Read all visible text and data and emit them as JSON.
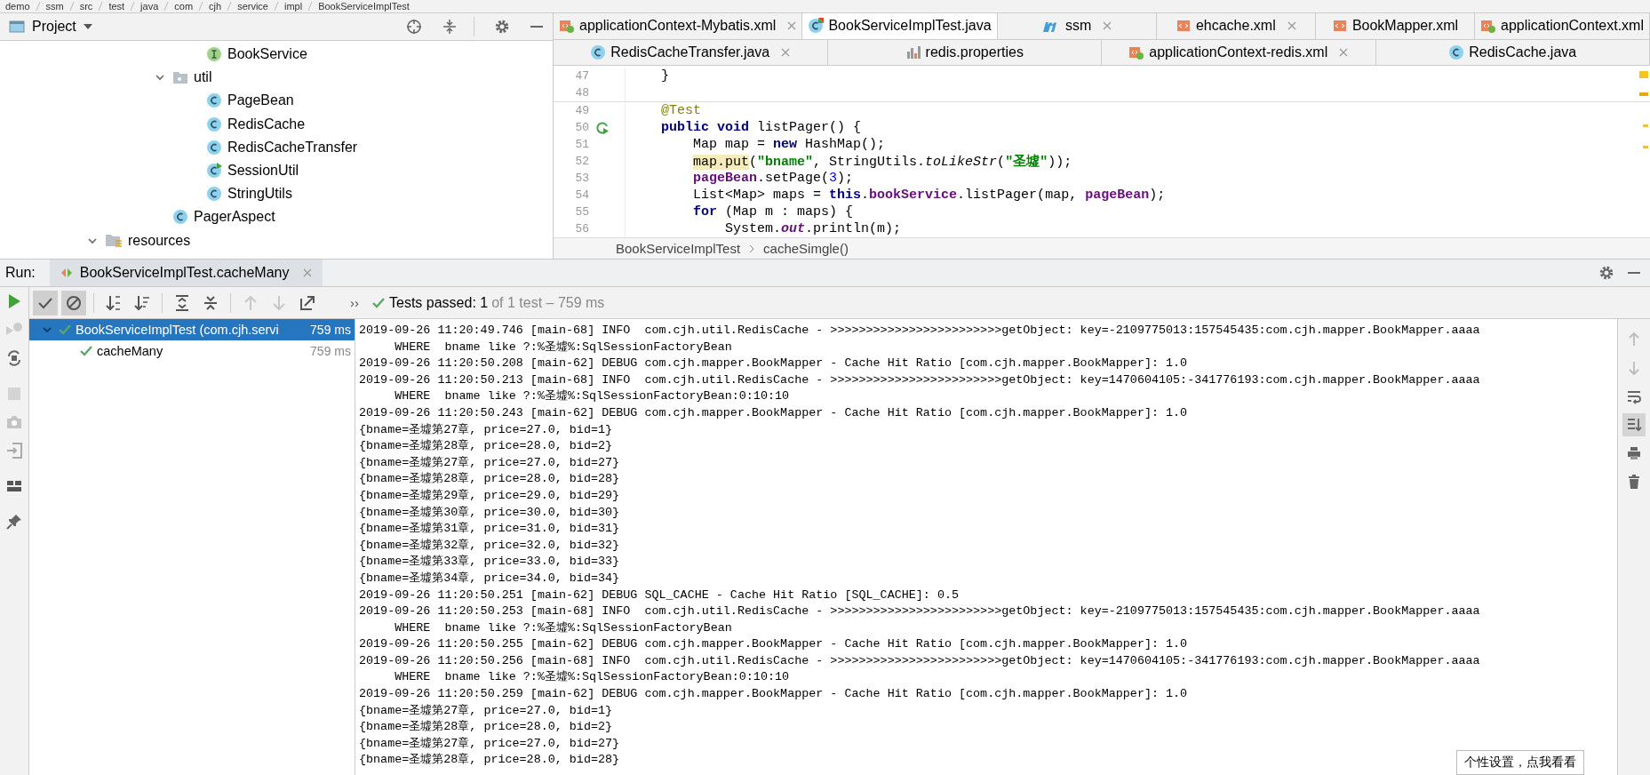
{
  "breadcrumbs": [
    "demo",
    "ssm",
    "src",
    "test",
    "java",
    "com",
    "cjh",
    "service",
    "impl",
    "BookServiceImplTest"
  ],
  "project_panel": {
    "title": "Project",
    "tree": [
      {
        "children": [
          {
            "children": [
              {
                "children": [
                  {
                    "label": "BookService",
                    "kind": "interface"
                  }
                ]
              },
              {
                "label": "util",
                "kind": "package",
                "expanded": true,
                "children": [
                  {
                    "label": "PageBean",
                    "kind": "class"
                  },
                  {
                    "label": "RedisCache",
                    "kind": "class"
                  },
                  {
                    "label": "RedisCacheTransfer",
                    "kind": "class"
                  },
                  {
                    "label": "SessionUtil",
                    "kind": "class-runnable"
                  },
                  {
                    "label": "StringUtils",
                    "kind": "class"
                  }
                ]
              },
              {
                "label": "PagerAspect",
                "kind": "class"
              }
            ]
          }
        ]
      },
      {
        "label": "resources",
        "kind": "resources",
        "expanded": true
      }
    ]
  },
  "editor_tab_rows": [
    {
      "tabs": [
        {
          "title": "applicationContext-Mybatis.xml",
          "kind": "spring-xml",
          "selected": false,
          "closable": true
        },
        {
          "title": "BookServiceImplTest.java",
          "kind": "test-class",
          "selected": true,
          "closable": false
        },
        {
          "title": "ssm",
          "kind": "maven",
          "selected": false,
          "closable": true
        },
        {
          "title": "ehcache.xml",
          "kind": "xml",
          "selected": false,
          "closable": true
        },
        {
          "title": "BookMapper.xml",
          "kind": "xml",
          "selected": false,
          "closable": false
        },
        {
          "title": "applicationContext.xml",
          "kind": "spring-xml",
          "selected": false,
          "closable": false
        }
      ]
    },
    {
      "tabs": [
        {
          "title": "RedisCacheTransfer.java",
          "kind": "class",
          "selected": false,
          "closable": true
        },
        {
          "title": "redis.properties",
          "kind": "properties",
          "selected": false,
          "closable": false
        },
        {
          "title": "applicationContext-redis.xml",
          "kind": "spring-xml",
          "selected": false,
          "closable": true
        },
        {
          "title": "RedisCache.java",
          "kind": "class",
          "selected": false,
          "closable": false
        }
      ]
    }
  ],
  "code_lines": [
    {
      "number": "47",
      "run_icon": false,
      "tokens": [
        {
          "text": "    }",
          "kind": "plain"
        }
      ]
    },
    {
      "number": "48",
      "run_icon": false
    },
    {
      "number": "49",
      "run_icon": false,
      "tokens": [
        {
          "text": "    @Test",
          "kind": "annotation"
        }
      ]
    },
    {
      "number": "50",
      "run_icon": true,
      "tokens": [
        {
          "text": "    public void",
          "kind": "keyword"
        },
        {
          "text": " listPager() {",
          "kind": "plain"
        }
      ]
    },
    {
      "number": "51",
      "run_icon": false,
      "tokens": [
        {
          "text": "        Map map = ",
          "kind": "plain"
        },
        {
          "text": "new",
          "kind": "keyword"
        },
        {
          "text": " HashMap();",
          "kind": "plain"
        }
      ]
    },
    {
      "number": "52",
      "run_icon": false,
      "tokens": [
        {
          "text": "        map.put",
          "kind": "highlight"
        },
        {
          "text": "(",
          "kind": "plain"
        },
        {
          "text": "\"bname\"",
          "kind": "string"
        },
        {
          "text": ", StringUtils.",
          "kind": "plain"
        },
        {
          "text": "toLikeStr",
          "kind": "static-method"
        },
        {
          "text": "(",
          "kind": "plain"
        },
        {
          "text": "\"圣墟\"",
          "kind": "string"
        },
        {
          "text": "));",
          "kind": "plain"
        }
      ]
    },
    {
      "number": "53",
      "run_icon": false,
      "tokens": [
        {
          "text": "        pageBean",
          "kind": "field"
        },
        {
          "text": ".setPage(",
          "kind": "plain"
        },
        {
          "text": "3",
          "kind": "number"
        },
        {
          "text": ");",
          "kind": "plain"
        }
      ]
    },
    {
      "number": "54",
      "run_icon": false,
      "tokens": [
        {
          "text": "        List<Map> maps = ",
          "kind": "plain"
        },
        {
          "text": "this",
          "kind": "keyword"
        },
        {
          "text": ".",
          "kind": "plain"
        },
        {
          "text": "bookService",
          "kind": "field"
        },
        {
          "text": ".listPager(map, ",
          "kind": "plain"
        },
        {
          "text": "pageBean",
          "kind": "field"
        },
        {
          "text": ");",
          "kind": "plain"
        }
      ]
    },
    {
      "number": "55",
      "run_icon": false,
      "tokens": [
        {
          "text": "        for",
          "kind": "keyword"
        },
        {
          "text": " (Map m : maps) {",
          "kind": "plain"
        }
      ]
    },
    {
      "number": "56",
      "run_icon": false,
      "tokens": [
        {
          "text": "            System.",
          "kind": "plain"
        },
        {
          "text": "out",
          "kind": "static-field"
        },
        {
          "text": ".println(m);",
          "kind": "plain"
        }
      ]
    }
  ],
  "editor_breadcrumbs": [
    "BookServiceImplTest",
    "cacheSimgle()"
  ],
  "run_panel": {
    "label": "Run:",
    "tab": "BookServiceImplTest.cacheMany",
    "side_tools": [
      {
        "kind": "run",
        "disabled": false
      },
      {
        "kind": "rerun-failed",
        "disabled": true
      },
      {
        "kind": "auto-test",
        "disabled": false
      },
      {
        "kind": "stop",
        "disabled": true
      },
      {
        "kind": "camera",
        "disabled": false
      },
      {
        "kind": "import",
        "disabled": false
      },
      {
        "kind": "layout",
        "disabled": false
      },
      {
        "kind": "pin",
        "disabled": false
      }
    ],
    "toolbar": [
      {
        "kind": "check",
        "selected": true,
        "disabled": false
      },
      {
        "kind": "ignored",
        "selected": true,
        "disabled": false
      },
      {
        "kind": "sort-alpha",
        "selected": false,
        "disabled": false
      },
      {
        "kind": "sort-duration",
        "selected": false,
        "disabled": false
      },
      {
        "kind": "expand",
        "selected": false,
        "disabled": false
      },
      {
        "kind": "collapse",
        "selected": false,
        "disabled": false
      },
      {
        "kind": "up",
        "selected": false,
        "disabled": true
      },
      {
        "kind": "down",
        "selected": false,
        "disabled": true
      },
      {
        "kind": "export",
        "selected": false,
        "disabled": false
      }
    ],
    "more": "››",
    "status_main": "Tests passed: 1",
    "status_detail": "of 1 test – 759 ms",
    "tests": [
      {
        "label": "BookServiceImplTest (com.cjh.servi",
        "duration": "759 ms",
        "passed": true,
        "selected": true,
        "expanded": true,
        "children": [
          {
            "label": "cacheMany",
            "duration": "759 ms",
            "passed": true,
            "selected": false
          }
        ]
      }
    ],
    "console_tools": [
      {
        "kind": "up",
        "selected": false
      },
      {
        "kind": "down",
        "selected": false
      },
      {
        "kind": "wrap",
        "selected": false
      },
      {
        "kind": "scroll-end",
        "selected": true
      },
      {
        "kind": "print",
        "selected": false
      },
      {
        "kind": "trash",
        "selected": false
      }
    ],
    "console_lines": [
      "2019-09-26 11:20:49.746 [main-68] INFO  com.cjh.util.RedisCache - >>>>>>>>>>>>>>>>>>>>>>>>getObject: key=-2109775013:157545435:com.cjh.mapper.BookMapper.aaaa",
      "     WHERE  bname like ?:%圣墟%:SqlSessionFactoryBean",
      "2019-09-26 11:20:50.208 [main-62] DEBUG com.cjh.mapper.BookMapper - Cache Hit Ratio [com.cjh.mapper.BookMapper]: 1.0",
      "2019-09-26 11:20:50.213 [main-68] INFO  com.cjh.util.RedisCache - >>>>>>>>>>>>>>>>>>>>>>>>getObject: key=1470604105:-341776193:com.cjh.mapper.BookMapper.aaaa",
      "     WHERE  bname like ?:%圣墟%:SqlSessionFactoryBean:0:10:10",
      "2019-09-26 11:20:50.243 [main-62] DEBUG com.cjh.mapper.BookMapper - Cache Hit Ratio [com.cjh.mapper.BookMapper]: 1.0",
      "{bname=圣墟第27章, price=27.0, bid=1}",
      "{bname=圣墟第28章, price=28.0, bid=2}",
      "{bname=圣墟第27章, price=27.0, bid=27}",
      "{bname=圣墟第28章, price=28.0, bid=28}",
      "{bname=圣墟第29章, price=29.0, bid=29}",
      "{bname=圣墟第30章, price=30.0, bid=30}",
      "{bname=圣墟第31章, price=31.0, bid=31}",
      "{bname=圣墟第32章, price=32.0, bid=32}",
      "{bname=圣墟第33章, price=33.0, bid=33}",
      "{bname=圣墟第34章, price=34.0, bid=34}",
      "2019-09-26 11:20:50.251 [main-62] DEBUG SQL_CACHE - Cache Hit Ratio [SQL_CACHE]: 0.5",
      "2019-09-26 11:20:50.253 [main-68] INFO  com.cjh.util.RedisCache - >>>>>>>>>>>>>>>>>>>>>>>>getObject: key=-2109775013:157545435:com.cjh.mapper.BookMapper.aaaa",
      "     WHERE  bname like ?:%圣墟%:SqlSessionFactoryBean",
      "2019-09-26 11:20:50.255 [main-62] DEBUG com.cjh.mapper.BookMapper - Cache Hit Ratio [com.cjh.mapper.BookMapper]: 1.0",
      "2019-09-26 11:20:50.256 [main-68] INFO  com.cjh.util.RedisCache - >>>>>>>>>>>>>>>>>>>>>>>>getObject: key=1470604105:-341776193:com.cjh.mapper.BookMapper.aaaa",
      "     WHERE  bname like ?:%圣墟%:SqlSessionFactoryBean:0:10:10",
      "2019-09-26 11:20:50.259 [main-62] DEBUG com.cjh.mapper.BookMapper - Cache Hit Ratio [com.cjh.mapper.BookMapper]: 1.0",
      "{bname=圣墟第27章, price=27.0, bid=1}",
      "{bname=圣墟第28章, price=28.0, bid=2}",
      "{bname=圣墟第27章, price=27.0, bid=27}",
      "{bname=圣墟第28章, price=28.0, bid=28}"
    ]
  },
  "tooltip": "个性设置，点我看看"
}
